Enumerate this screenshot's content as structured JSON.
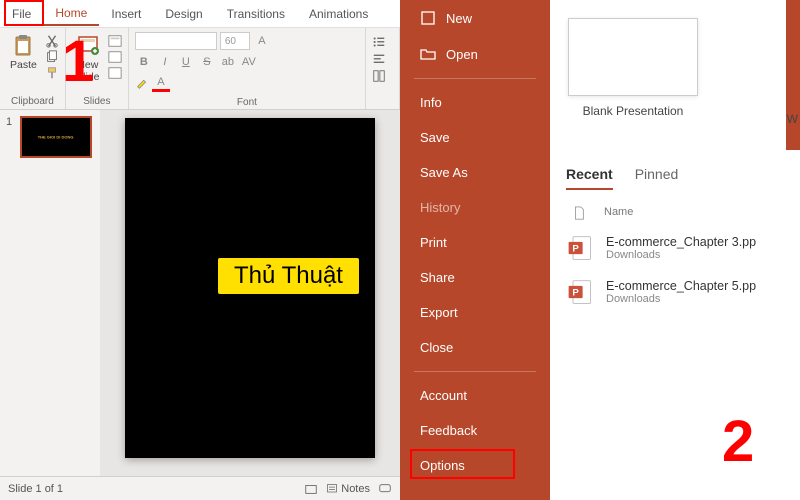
{
  "ribbon": {
    "tabs": [
      "File",
      "Home",
      "Insert",
      "Design",
      "Transitions",
      "Animations"
    ],
    "active_tab": "Home",
    "clipboard": {
      "paste": "Paste",
      "label": "Clipboard"
    },
    "slides": {
      "new_slide": "New\nSlide",
      "label": "Slides"
    },
    "font": {
      "family_placeholder": "",
      "size_placeholder": "60",
      "label": "Font",
      "buttons": {
        "bold": "B",
        "italic": "I",
        "underline": "U",
        "strike": "S"
      }
    }
  },
  "thumbnails": [
    {
      "num": "1",
      "text": "THE GIOI DI DONG"
    }
  ],
  "statusbar": {
    "slide_info": "Slide 1 of 1",
    "notes": "Notes"
  },
  "backstage": {
    "top_items": [
      {
        "icon": "new",
        "label": "New"
      },
      {
        "icon": "open",
        "label": "Open"
      }
    ],
    "mid_items": [
      "Info",
      "Save",
      "Save As",
      "History",
      "Print",
      "Share",
      "Export",
      "Close"
    ],
    "muted": [
      "History"
    ],
    "bottom_items": [
      "Account",
      "Feedback",
      "Options"
    ]
  },
  "templates": [
    {
      "name": "Blank Presentation"
    }
  ],
  "recent": {
    "tabs": [
      "Recent",
      "Pinned"
    ],
    "active": "Recent",
    "col_name": "Name",
    "items": [
      {
        "name": "E-commerce_Chapter 3.pp",
        "loc": "Downloads"
      },
      {
        "name": "E-commerce_Chapter 5.pp",
        "loc": "Downloads"
      }
    ]
  },
  "annotations": {
    "one": "1",
    "two": "2",
    "watermark": "Thủ Thuật"
  },
  "truncated_right": "W"
}
